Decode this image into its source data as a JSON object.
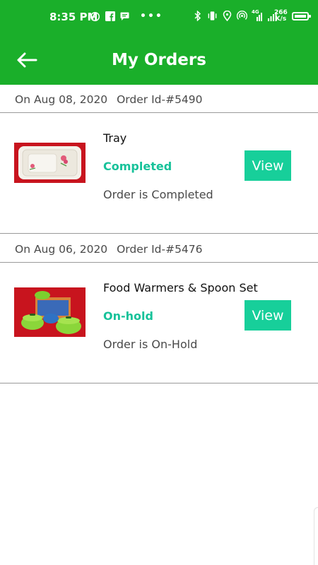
{
  "status_bar": {
    "time": "8:35 PM",
    "dots": "•••",
    "speed_value": "266",
    "speed_unit": "K/s",
    "network_label": "4G",
    "icons": [
      "whatsapp-icon",
      "facebook-icon",
      "message-icon",
      "bluetooth-icon",
      "vibrate-icon",
      "location-icon",
      "hotspot-icon",
      "mobile-data-icon",
      "signal-icon",
      "battery-icon"
    ]
  },
  "app_bar": {
    "title": "My Orders",
    "back_icon": "arrow-left-icon"
  },
  "colors": {
    "primary": "#1aaf2a",
    "accent": "#17cf9a",
    "status_text": "#17c29a"
  },
  "orders": [
    {
      "date": "On Aug 08, 2020",
      "order_id": "Order Id-#5490",
      "product_name": "Tray",
      "status": "Completed",
      "status_text": "Order is Completed",
      "view_label": "View"
    },
    {
      "date": "On Aug 06, 2020",
      "order_id": "Order Id-#5476",
      "product_name": "Food Warmers & Spoon Set",
      "status": "On-hold",
      "status_text": "Order is On-Hold",
      "view_label": "View"
    }
  ]
}
